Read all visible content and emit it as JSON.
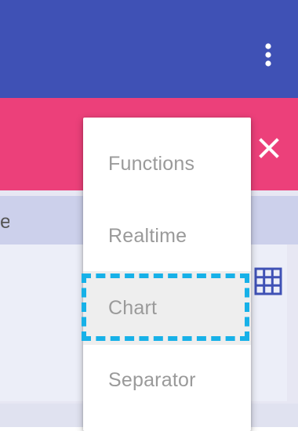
{
  "appbar": {
    "more_icon": "more-vert-icon",
    "color": "#3f51b5"
  },
  "selection_bar": {
    "close_icon": "close-icon",
    "color": "#ec407a"
  },
  "list": {
    "header_text": "e",
    "grid_icon": "grid-icon",
    "accent": "#3f51b5"
  },
  "menu": {
    "items": [
      {
        "label": "Functions"
      },
      {
        "label": "Realtime"
      },
      {
        "label": "Chart",
        "highlighted": true
      },
      {
        "label": "Separator"
      }
    ],
    "highlight_color": "#17b1e8"
  }
}
